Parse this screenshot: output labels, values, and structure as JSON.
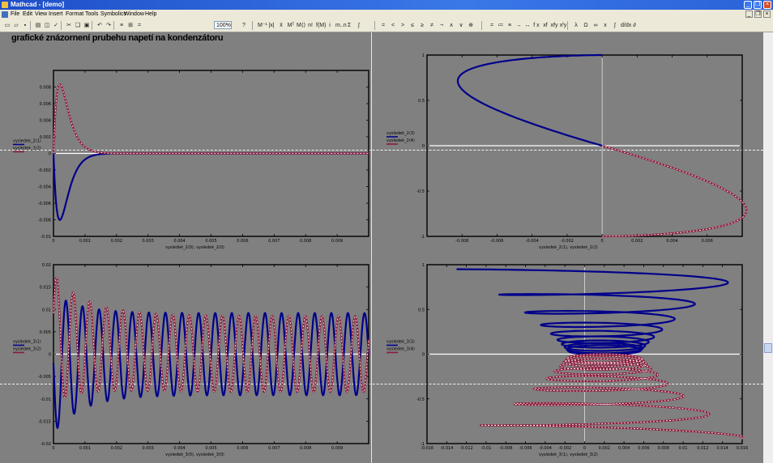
{
  "window": {
    "title": "Mathcad - [demo]",
    "minimize": "_",
    "restore": "❐",
    "close": "×"
  },
  "menu": [
    "File",
    "Edit",
    "View",
    "Insert",
    "Format",
    "Tools",
    "Symbolics",
    "Window",
    "Help"
  ],
  "toolbar": {
    "zoom": "100%",
    "icons": [
      "new-icon",
      "open-icon",
      "save-icon",
      "print-icon",
      "preview-icon",
      "spell-icon",
      "cut-icon",
      "copy-icon",
      "paste-icon",
      "undo-icon",
      "redo-icon",
      "align-icon",
      "resource-icon",
      "calculate-icon"
    ],
    "matrix_ops": [
      "M⁻¹",
      "|x|",
      "x̄",
      "Mᵀ",
      "M⟨⟩",
      "n!",
      "f(M)",
      "i",
      "m..n",
      "Σ",
      "∫"
    ],
    "relational": [
      "=",
      "<",
      ">",
      "≤",
      "≥",
      "≠",
      "¬",
      "∧",
      "∨",
      "⊕"
    ],
    "evaluation": [
      "=",
      "≔",
      "≡",
      "→",
      "↔",
      "f x",
      "xf",
      "xfy",
      "xᶠy"
    ],
    "greek": [
      "λ",
      "Ω",
      "∞",
      "x",
      "∫",
      "d/dx",
      "∂"
    ]
  },
  "document": {
    "title": "grafické znázornení prubehu napetí na kondenzátoru"
  },
  "colors": {
    "blue": "#00008b",
    "red": "#8b1a3a",
    "dash": "#ffffff",
    "background": "#808080"
  },
  "chart_data": [
    {
      "type": "line",
      "position": "top-left",
      "title": "",
      "xlabel": "vysledek_2⟨0⟩, vysledek_2⟨0⟩",
      "ylabel": "",
      "xlim": [
        0,
        0.01
      ],
      "ylim": [
        -0.01,
        0.01
      ],
      "xticks": [
        "0",
        "0.001",
        "0.002",
        "0.003",
        "0.004",
        "0.005",
        "0.006",
        "0.007",
        "0.008",
        "0.009"
      ],
      "yticks": [
        "0.008",
        "0.006",
        "0.004",
        "0.002",
        "0",
        "-0.002",
        "-0.004",
        "-0.006",
        "-0.008",
        "-0.01"
      ],
      "legend": [
        {
          "name": "vysledek_2⟨1⟩",
          "color": "#00008b"
        },
        {
          "name": "vysledek_2⟨2⟩",
          "color": "#8b1a3a"
        }
      ],
      "series": [
        {
          "name": "vysledek_2⟨1⟩",
          "color": "#00008b",
          "shape": "damped-negative",
          "peak": {
            "x": 0.0002,
            "y": -0.0082
          },
          "tail": 0
        },
        {
          "name": "vysledek_2⟨2⟩",
          "color": "#8b1a3a",
          "shape": "damped-positive",
          "peak": {
            "x": 0.0002,
            "y": 0.0085
          },
          "tail": 0
        }
      ]
    },
    {
      "type": "line",
      "position": "top-right",
      "title": "",
      "xlabel": "vysledek_2⟨1⟩, vysledek_2⟨2⟩",
      "ylabel": "",
      "xlim": [
        -0.01,
        0.008
      ],
      "ylim": [
        -1,
        1
      ],
      "xticks": [
        "-0.008",
        "-0.006",
        "-0.004",
        "-0.002",
        "0",
        "0.002",
        "0.004",
        "0.006"
      ],
      "yticks": [
        "1",
        "0.5",
        "0",
        "-0.5",
        "-1"
      ],
      "legend": [
        {
          "name": "vysledek_2⟨3⟩",
          "color": "#00008b"
        },
        {
          "name": "vysledek_2⟨4⟩",
          "color": "#8b1a3a"
        }
      ],
      "series": [
        {
          "name": "vysledek_2⟨3⟩",
          "color": "#00008b",
          "points": [
            [
              0,
              0
            ],
            [
              -0.0082,
              0.85
            ],
            [
              -0.0075,
              1.0
            ],
            [
              -0.001,
              1.0
            ]
          ]
        },
        {
          "name": "vysledek_2⟨4⟩",
          "color": "#8b1a3a",
          "points": [
            [
              0,
              0
            ],
            [
              0.0085,
              -0.85
            ],
            [
              0.0075,
              -1.0
            ],
            [
              0.001,
              -1.0
            ]
          ]
        }
      ]
    },
    {
      "type": "line",
      "position": "bottom-left",
      "title": "",
      "xlabel": "vysledek_3⟨0⟩, vysledek_3⟨0⟩",
      "ylabel": "",
      "xlim": [
        0,
        0.01
      ],
      "ylim": [
        -0.02,
        0.02
      ],
      "xticks": [
        "0",
        "0.001",
        "0.002",
        "0.003",
        "0.004",
        "0.005",
        "0.006",
        "0.007",
        "0.008",
        "0.009"
      ],
      "yticks": [
        "0.02",
        "0.015",
        "0.01",
        "0.005",
        "0",
        "-0.005",
        "-0.01",
        "-0.015",
        "-0.02"
      ],
      "legend": [
        {
          "name": "vysledek_3⟨1⟩",
          "color": "#00008b"
        },
        {
          "name": "vysledek_3⟨2⟩",
          "color": "#8b1a3a"
        }
      ],
      "series": [
        {
          "name": "vysledek_3⟨1⟩",
          "color": "#00008b",
          "shape": "oscillation",
          "offset": 0,
          "amplitude": 0.0092,
          "cycles": 19,
          "initial_peak": -0.0155
        },
        {
          "name": "vysledek_3⟨2⟩",
          "color": "#8b1a3a",
          "shape": "oscillation",
          "offset": 0.0035,
          "amplitude": 0.0085,
          "cycles": 19,
          "initial_peak": 0.016
        }
      ]
    },
    {
      "type": "line",
      "position": "bottom-right",
      "title": "",
      "xlabel": "vysledek_3⟨1⟩, vysledek_3⟨2⟩",
      "ylabel": "",
      "xlim": [
        -0.016,
        0.016
      ],
      "ylim": [
        -1,
        1
      ],
      "xticks": [
        "-0.016",
        "-0.014",
        "-0.012",
        "-0.01",
        "-0.008",
        "-0.006",
        "-0.004",
        "-0.002",
        "0",
        "0.002",
        "0.004",
        "0.006",
        "0.008",
        "0.01",
        "0.012",
        "0.014",
        "0.016"
      ],
      "yticks": [
        "1",
        "0.5",
        "0",
        "-0.5",
        "-1"
      ],
      "legend": [
        {
          "name": "vysledek_3⟨3⟩",
          "color": "#00008b"
        },
        {
          "name": "vysledek_3⟨4⟩",
          "color": "#8b1a3a"
        }
      ],
      "series": [
        {
          "name": "vysledek_3⟨3⟩",
          "color": "#00008b",
          "shape": "spiral-upper"
        },
        {
          "name": "vysledek_3⟨4⟩",
          "color": "#8b1a3a",
          "shape": "spiral-lower"
        }
      ]
    }
  ]
}
